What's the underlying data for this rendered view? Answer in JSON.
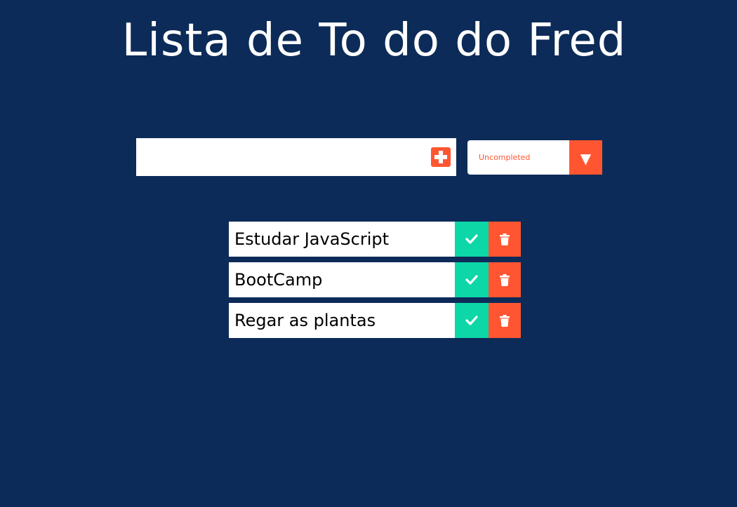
{
  "header": {
    "title": "Lista de To do do Fred"
  },
  "form": {
    "input_value": "",
    "input_placeholder": "",
    "add_icon": "plus-square-icon"
  },
  "filter": {
    "selected": "Uncompleted",
    "arrow": "▼"
  },
  "colors": {
    "background": "#0c2b58",
    "accent": "#ff5631",
    "complete": "#0dd6a7"
  },
  "todos": [
    {
      "text": "Estudar JavaScript",
      "complete_icon": "check-icon",
      "delete_icon": "trash-icon"
    },
    {
      "text": "BootCamp",
      "complete_icon": "check-icon",
      "delete_icon": "trash-icon"
    },
    {
      "text": "Regar as plantas",
      "complete_icon": "check-icon",
      "delete_icon": "trash-icon"
    }
  ]
}
